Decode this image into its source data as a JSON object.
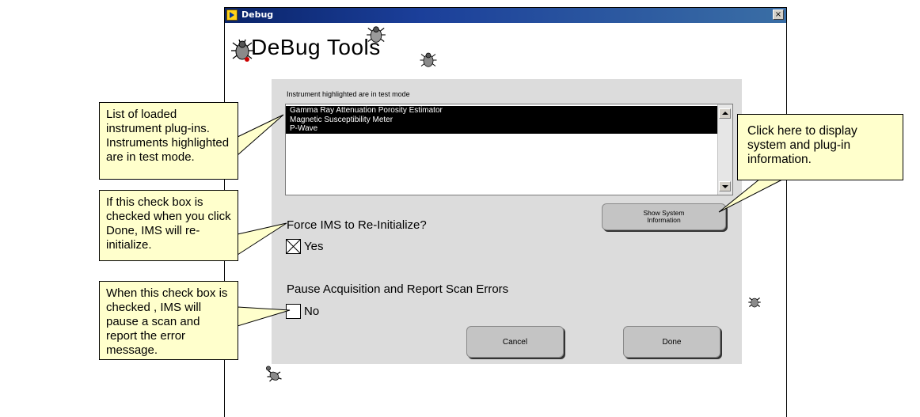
{
  "window": {
    "title": "Debug",
    "close_glyph": "×",
    "app_title": "DeBug Tools"
  },
  "instruments": {
    "caption": "Instrument highlighted are in test mode",
    "items": [
      {
        "label": "Gamma Ray Attenuation Porosity Estimator",
        "highlighted": true
      },
      {
        "label": "Magnetic Susceptibility Meter",
        "highlighted": true
      },
      {
        "label": "P-Wave",
        "highlighted": true
      }
    ]
  },
  "buttons": {
    "sysinfo_line1": "Show System",
    "sysinfo_line2": "Information",
    "cancel": "Cancel",
    "done": "Done"
  },
  "force_init": {
    "question": "Force IMS to Re-Initialize?",
    "option": "Yes",
    "checked": true
  },
  "pause": {
    "question": "Pause Acquisition and  Report Scan Errors",
    "option": "No",
    "checked": false
  },
  "callouts": {
    "list": "List of loaded instrument plug-ins.  Instruments highlighted are in test mode.",
    "force": "If this check box is checked when you click Done, IMS will re-initialize.",
    "pause": "When this check box is checked ,  IMS will pause a scan and report the error message.",
    "sysinfo": "Click here to display system and plug-in information."
  },
  "colors": {
    "callout_fill": "#ffffcc",
    "panel": "#dcdcdc",
    "titlebar": "#0a246a",
    "list_highlight": "#000000"
  },
  "icons": [
    "bug-icon",
    "close-icon",
    "scroll-up-icon",
    "scroll-down-icon",
    "check-x-icon"
  ]
}
